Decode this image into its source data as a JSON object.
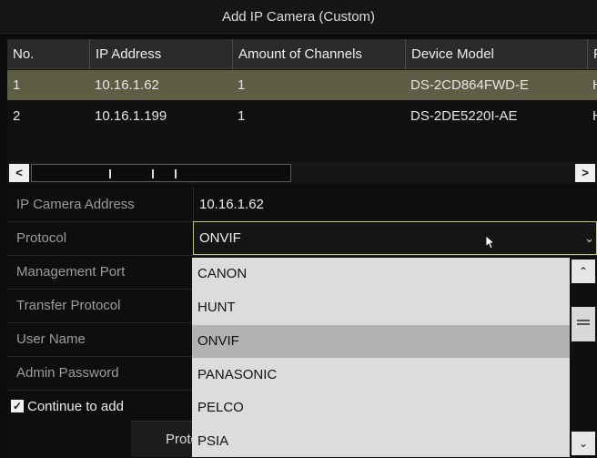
{
  "window": {
    "title": "Add IP Camera (Custom)"
  },
  "table": {
    "headers": [
      "No.",
      "IP Address",
      "Amount of Channels",
      "Device Model",
      "F"
    ],
    "rows": [
      {
        "no": "1",
        "ip": "10.16.1.62",
        "channels": "1",
        "model": "DS-2CD864FWD-E",
        "extra": "H"
      },
      {
        "no": "2",
        "ip": "10.16.1.199",
        "channels": "1",
        "model": "DS-2DE5220I-AE",
        "extra": "H"
      }
    ],
    "selected_row": 1,
    "scroll_left": "<",
    "scroll_right": ">"
  },
  "form": {
    "ip_address_label": "IP Camera Address",
    "ip_address_value": "10.16.1.62",
    "protocol_label": "Protocol",
    "protocol_value": "ONVIF",
    "mgmt_port_label": "Management Port",
    "transfer_protocol_label": "Transfer Protocol",
    "user_name_label": "User Name",
    "admin_password_label": "Admin Password",
    "continue_label": "Continue to add",
    "continue_checked": true,
    "bottom_button_label": "Proto"
  },
  "dropdown": {
    "options": [
      "CANON",
      "HUNT",
      "ONVIF",
      "PANASONIC",
      "PELCO",
      "PSIA"
    ],
    "highlighted": "ONVIF"
  },
  "colors": {
    "selected_row": "#5d5e44",
    "active_border": "#c6c66a",
    "dropdown_bg": "#dcdcdc",
    "dropdown_highlight": "#b2b2b2"
  }
}
